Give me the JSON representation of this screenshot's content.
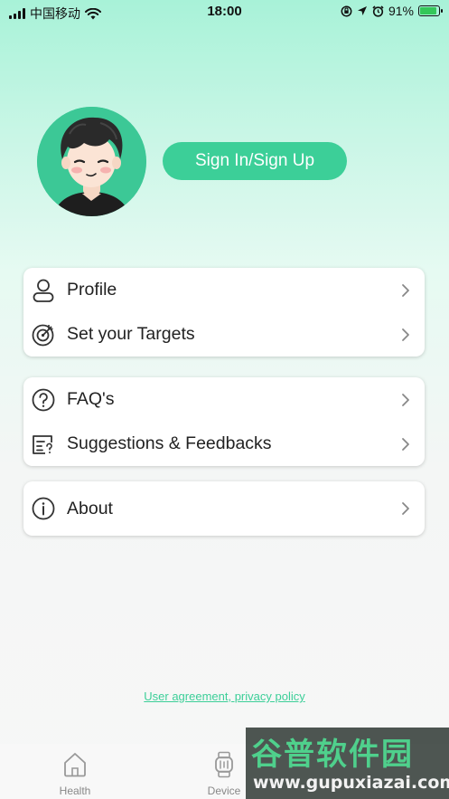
{
  "status_bar": {
    "carrier": "中国移动",
    "time": "18:00",
    "battery_percent": "91%",
    "battery_level": 0.91,
    "icons": [
      "signal-icon",
      "wifi-icon",
      "orientation-lock-icon",
      "location-icon",
      "alarm-icon",
      "battery-icon"
    ]
  },
  "header": {
    "signin_label": "Sign In/Sign Up",
    "avatar_icon": "avatar-illustration"
  },
  "menu_groups": [
    [
      {
        "label": "Profile",
        "icon": "person-icon"
      },
      {
        "label": "Set your Targets",
        "icon": "target-icon"
      }
    ],
    [
      {
        "label": "FAQ's",
        "icon": "question-icon"
      },
      {
        "label": "Suggestions & Feedbacks",
        "icon": "feedback-icon"
      }
    ],
    [
      {
        "label": "About",
        "icon": "info-icon"
      }
    ]
  ],
  "footer": {
    "legal_link": "User agreement, privacy policy"
  },
  "tabbar": {
    "tabs": [
      {
        "label": "Health",
        "icon": "home-icon"
      },
      {
        "label": "Device",
        "icon": "watch-icon"
      }
    ]
  },
  "watermark": {
    "title": "谷普软件园",
    "url": "www.gupuxiazai.com"
  },
  "colors": {
    "accent": "#3ccf98",
    "avatar_bg": "#3cc896"
  }
}
